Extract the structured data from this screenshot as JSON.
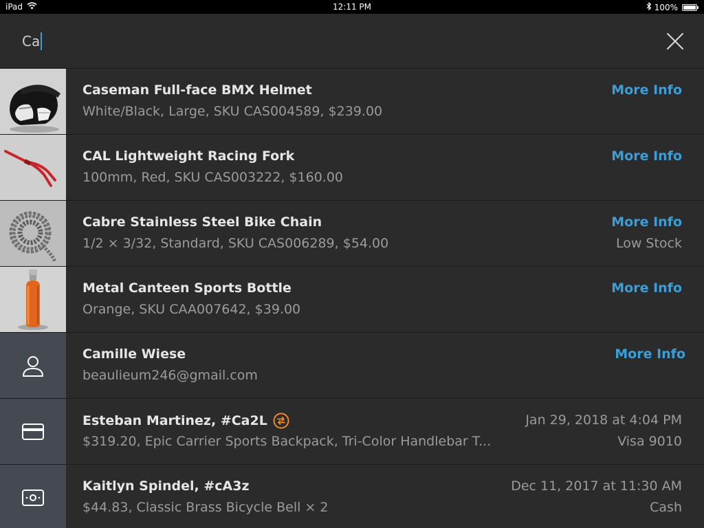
{
  "status_bar": {
    "device": "iPad",
    "time": "12:11 PM",
    "battery": "100%",
    "battery_level": 1.0
  },
  "search": {
    "query": "Ca"
  },
  "colors": {
    "accent": "#3a9fd8",
    "orange_badge": "#f08a24",
    "background": "#2b2b2c",
    "icon_tile": "#454a52"
  },
  "results": [
    {
      "kind": "item",
      "thumbnail": "helmet-photo",
      "title": "Caseman Full-face BMX Helmet",
      "subtitle": "White/Black, Large, SKU CAS004589, $239.00",
      "action": "More Info"
    },
    {
      "kind": "item",
      "thumbnail": "fork-photo",
      "title": "CAL Lightweight Racing Fork",
      "subtitle": "100mm, Red, SKU CAS003222, $160.00",
      "action": "More Info"
    },
    {
      "kind": "item",
      "thumbnail": "chain-photo",
      "title": "Cabre Stainless Steel Bike Chain",
      "subtitle": "1/2 × 3/32, Standard, SKU CAS006289, $54.00",
      "action": "More Info",
      "stock_status": "Low Stock"
    },
    {
      "kind": "item",
      "thumbnail": "bottle-photo",
      "title": "Metal Canteen Sports Bottle",
      "subtitle": "Orange, SKU CAA007642, $39.00",
      "action": "More Info"
    },
    {
      "kind": "customer",
      "icon": "person-icon",
      "title": "Camille Wiese",
      "subtitle": "beaulieum246@gmail.com",
      "action": "More Info"
    },
    {
      "kind": "transaction",
      "icon": "credit-card-icon",
      "badge_icon": "exchange-icon",
      "title": "Esteban Martinez, #Ca2L",
      "subtitle": "$319.20, Epic Carrier Sports Backpack, Tri-Color Handlebar T...",
      "date": "Jan 29, 2018 at 4:04 PM",
      "payment": "Visa 9010"
    },
    {
      "kind": "transaction",
      "icon": "cash-icon",
      "title": "Kaitlyn Spindel, #cA3z",
      "subtitle": "$44.83, Classic Brass Bicycle Bell × 2",
      "date": "Dec 11, 2017 at 11:30 AM",
      "payment": "Cash"
    }
  ]
}
